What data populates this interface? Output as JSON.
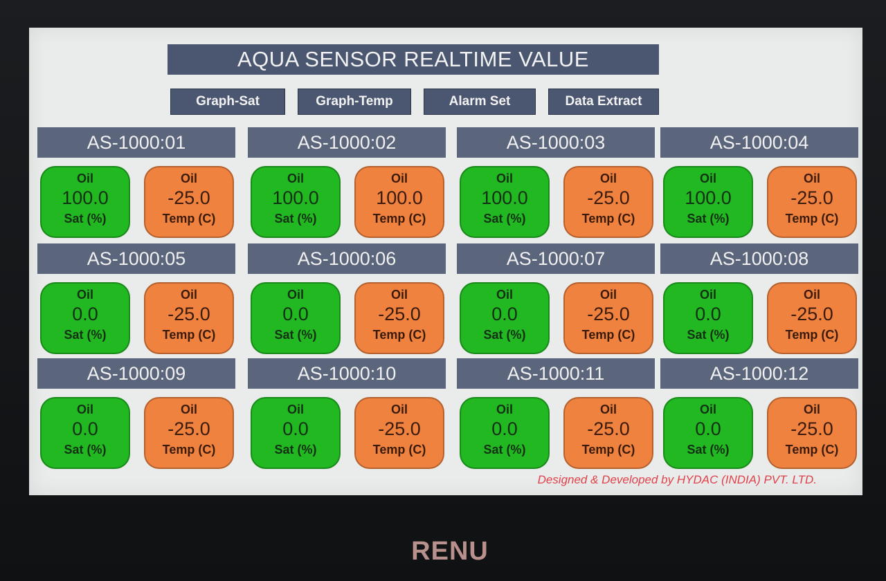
{
  "app": {
    "title": "AQUA SENSOR REALTIME VALUE",
    "footer": "Designed & Developed by HYDAC (INDIA) PVT. LTD.",
    "device_brand": "RENU"
  },
  "nav": [
    {
      "label": "Graph-Sat"
    },
    {
      "label": "Graph-Temp"
    },
    {
      "label": "Alarm Set"
    },
    {
      "label": "Data Extract"
    }
  ],
  "colors": {
    "header_bg": "#4b5770",
    "sat_tile": "#22b822",
    "temp_tile": "#f08240",
    "footer_text": "#e0414a"
  },
  "sensors": [
    {
      "id": "AS-1000:01",
      "sat": {
        "medium": "Oil",
        "value": "100.0",
        "unit": "Sat (%)"
      },
      "temp": {
        "medium": "Oil",
        "value": "-25.0",
        "unit": "Temp (C)"
      }
    },
    {
      "id": "AS-1000:02",
      "sat": {
        "medium": "Oil",
        "value": "100.0",
        "unit": "Sat (%)"
      },
      "temp": {
        "medium": "Oil",
        "value": "100.0",
        "unit": "Temp (C)"
      }
    },
    {
      "id": "AS-1000:03",
      "sat": {
        "medium": "Oil",
        "value": "100.0",
        "unit": "Sat (%)"
      },
      "temp": {
        "medium": "Oil",
        "value": "-25.0",
        "unit": "Temp (C)"
      }
    },
    {
      "id": "AS-1000:04",
      "sat": {
        "medium": "Oil",
        "value": "100.0",
        "unit": "Sat (%)"
      },
      "temp": {
        "medium": "Oil",
        "value": "-25.0",
        "unit": "Temp (C)"
      }
    },
    {
      "id": "AS-1000:05",
      "sat": {
        "medium": "Oil",
        "value": "0.0",
        "unit": "Sat (%)"
      },
      "temp": {
        "medium": "Oil",
        "value": "-25.0",
        "unit": "Temp (C)"
      }
    },
    {
      "id": "AS-1000:06",
      "sat": {
        "medium": "Oil",
        "value": "0.0",
        "unit": "Sat (%)"
      },
      "temp": {
        "medium": "Oil",
        "value": "-25.0",
        "unit": "Temp (C)"
      }
    },
    {
      "id": "AS-1000:07",
      "sat": {
        "medium": "Oil",
        "value": "0.0",
        "unit": "Sat (%)"
      },
      "temp": {
        "medium": "Oil",
        "value": "-25.0",
        "unit": "Temp (C)"
      }
    },
    {
      "id": "AS-1000:08",
      "sat": {
        "medium": "Oil",
        "value": "0.0",
        "unit": "Sat (%)"
      },
      "temp": {
        "medium": "Oil",
        "value": "-25.0",
        "unit": "Temp (C)"
      }
    },
    {
      "id": "AS-1000:09",
      "sat": {
        "medium": "Oil",
        "value": "0.0",
        "unit": "Sat (%)"
      },
      "temp": {
        "medium": "Oil",
        "value": "-25.0",
        "unit": "Temp (C)"
      }
    },
    {
      "id": "AS-1000:10",
      "sat": {
        "medium": "Oil",
        "value": "0.0",
        "unit": "Sat (%)"
      },
      "temp": {
        "medium": "Oil",
        "value": "-25.0",
        "unit": "Temp (C)"
      }
    },
    {
      "id": "AS-1000:11",
      "sat": {
        "medium": "Oil",
        "value": "0.0",
        "unit": "Sat (%)"
      },
      "temp": {
        "medium": "Oil",
        "value": "-25.0",
        "unit": "Temp (C)"
      }
    },
    {
      "id": "AS-1000:12",
      "sat": {
        "medium": "Oil",
        "value": "0.0",
        "unit": "Sat (%)"
      },
      "temp": {
        "medium": "Oil",
        "value": "-25.0",
        "unit": "Temp (C)"
      }
    }
  ]
}
